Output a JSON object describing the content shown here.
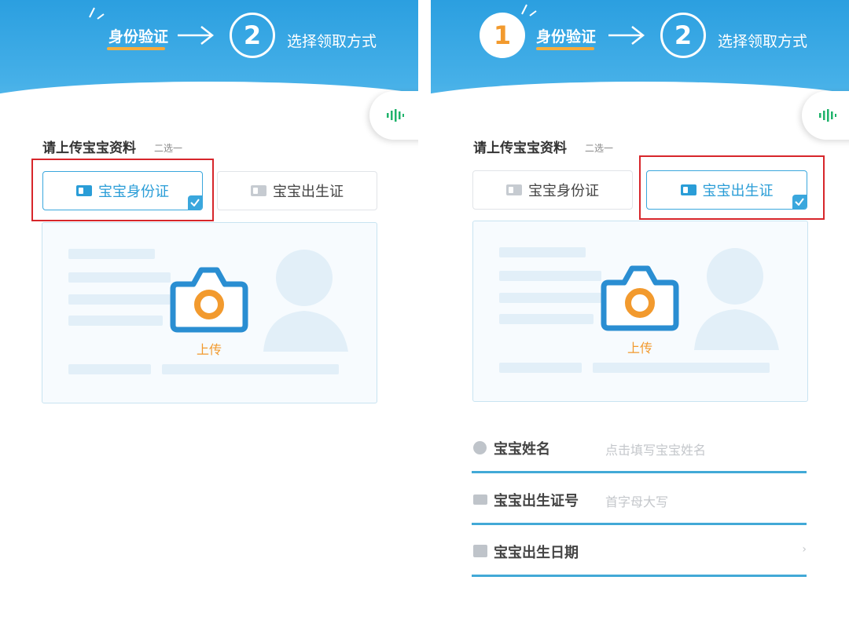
{
  "colors": {
    "header_blue": "#2b9fe0",
    "accent_blue": "#3aa7dd",
    "orange": "#f29a2e",
    "highlight_red": "#d7262b"
  },
  "left": {
    "stepper": {
      "step1_label": "身份验证",
      "step2_number": "2",
      "step2_label": "选择领取方式"
    },
    "voice_icon": "voice-wave-icon",
    "section": {
      "title": "请上传宝宝资料",
      "hint": "二选一"
    },
    "options": [
      {
        "label": "宝宝身份证",
        "selected": true
      },
      {
        "label": "宝宝出生证",
        "selected": false
      }
    ],
    "upload": {
      "label": "上传"
    }
  },
  "right": {
    "stepper": {
      "step1_number": "1",
      "step1_label": "身份验证",
      "step2_number": "2",
      "step2_label": "选择领取方式"
    },
    "voice_icon": "voice-wave-icon",
    "section": {
      "title": "请上传宝宝资料",
      "hint": "二选一"
    },
    "options": [
      {
        "label": "宝宝身份证",
        "selected": false
      },
      {
        "label": "宝宝出生证",
        "selected": true
      }
    ],
    "upload": {
      "label": "上传"
    },
    "form": {
      "name": {
        "label": "宝宝姓名",
        "placeholder": "点击填写宝宝姓名"
      },
      "cert_no": {
        "label": "宝宝出生证号",
        "placeholder": "首字母大写"
      },
      "birth_date": {
        "label": "宝宝出生日期",
        "chevron": "›"
      }
    }
  }
}
